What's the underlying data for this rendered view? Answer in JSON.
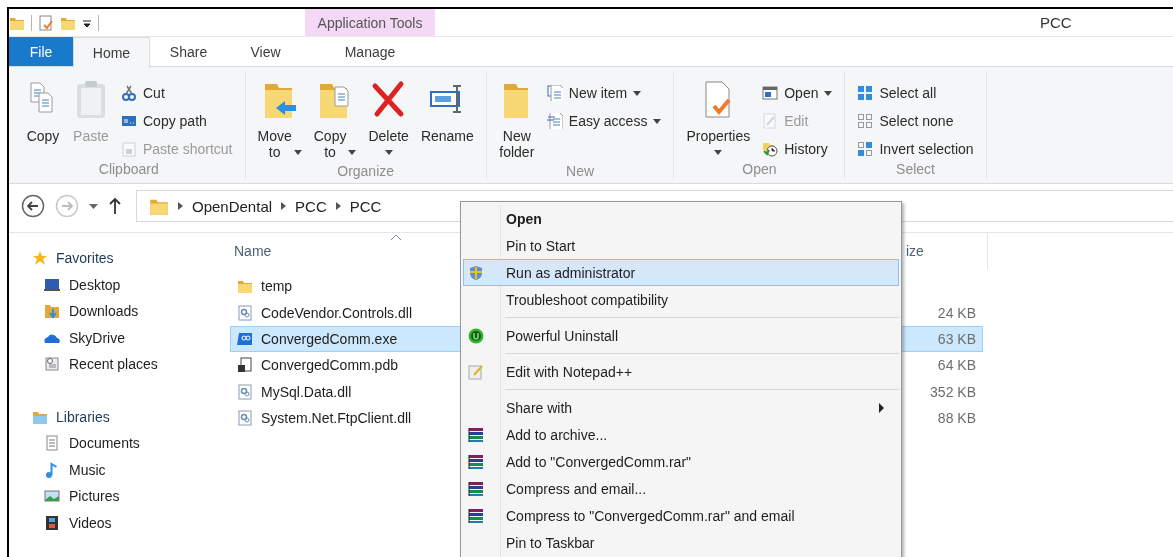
{
  "title_bar": {
    "context_tab_group": "Application Tools",
    "title": "PCC"
  },
  "ribbon_tabs": [
    {
      "label": "File",
      "kind": "file",
      "selected": false
    },
    {
      "label": "Home",
      "kind": "tab",
      "selected": true
    },
    {
      "label": "Share",
      "kind": "tab",
      "selected": false
    },
    {
      "label": "View",
      "kind": "tab",
      "selected": false
    },
    {
      "label": "Manage",
      "kind": "context",
      "selected": false
    }
  ],
  "ribbon_groups": [
    {
      "label": "Clipboard",
      "commands": [
        {
          "label": "Copy",
          "kind": "large",
          "disabled": false,
          "dropdown": false
        },
        {
          "label": "Paste",
          "kind": "large",
          "disabled": true,
          "dropdown": false
        },
        {
          "label": "Cut",
          "kind": "small",
          "disabled": false,
          "dropdown": false
        },
        {
          "label": "Copy path",
          "kind": "small",
          "disabled": false,
          "dropdown": false
        },
        {
          "label": "Paste shortcut",
          "kind": "small",
          "disabled": true,
          "dropdown": false
        }
      ]
    },
    {
      "label": "Organize",
      "commands": [
        {
          "label": "Move to",
          "kind": "large",
          "disabled": false,
          "dropdown": true
        },
        {
          "label": "Copy to",
          "kind": "large",
          "disabled": false,
          "dropdown": true
        },
        {
          "label": "Delete",
          "kind": "tall",
          "disabled": false,
          "dropdown": true
        },
        {
          "label": "Rename",
          "kind": "large",
          "disabled": false,
          "dropdown": false
        }
      ]
    },
    {
      "label": "New",
      "commands": [
        {
          "label": "New folder",
          "kind": "large",
          "disabled": false,
          "dropdown": false
        },
        {
          "label": "New item",
          "kind": "small",
          "disabled": false,
          "dropdown": true
        },
        {
          "label": "Easy access",
          "kind": "small",
          "disabled": false,
          "dropdown": true
        }
      ]
    },
    {
      "label": "Open",
      "commands": [
        {
          "label": "Properties",
          "kind": "tall",
          "disabled": false,
          "dropdown": true
        },
        {
          "label": "Open",
          "kind": "small",
          "disabled": false,
          "dropdown": true
        },
        {
          "label": "Edit",
          "kind": "small",
          "disabled": true,
          "dropdown": false
        },
        {
          "label": "History",
          "kind": "small",
          "disabled": false,
          "dropdown": false
        }
      ]
    },
    {
      "label": "Select",
      "commands": [
        {
          "label": "Select all",
          "kind": "small",
          "disabled": false,
          "dropdown": false
        },
        {
          "label": "Select none",
          "kind": "small",
          "disabled": false,
          "dropdown": false
        },
        {
          "label": "Invert selection",
          "kind": "small",
          "disabled": false,
          "dropdown": false
        }
      ]
    }
  ],
  "address_bar": {
    "forward_disabled": true,
    "path": [
      "OpenDental",
      "PCC",
      "PCC"
    ]
  },
  "navigation": [
    {
      "label": "Favorites",
      "items": [
        "Desktop",
        "Downloads",
        "SkyDrive",
        "Recent places"
      ]
    },
    {
      "label": "Libraries",
      "items": [
        "Documents",
        "Music",
        "Pictures",
        "Videos"
      ]
    }
  ],
  "file_list": {
    "columns": [
      {
        "label": "Name",
        "sorted": true
      },
      {
        "label": "ize",
        "sorted": false
      }
    ],
    "rows": [
      {
        "name": "temp",
        "kind": "folder",
        "size": "",
        "selected": false
      },
      {
        "name": "CodeVendor.Controls.dll",
        "kind": "dll",
        "size": "24 KB",
        "selected": false
      },
      {
        "name": "ConvergedComm.exe",
        "kind": "exe",
        "size": "63 KB",
        "selected": true
      },
      {
        "name": "ConvergedComm.pdb",
        "kind": "pdb",
        "size": "64 KB",
        "selected": false
      },
      {
        "name": "MySql.Data.dll",
        "kind": "dll",
        "size": "352 KB",
        "selected": false
      },
      {
        "name": "System.Net.FtpClient.dll",
        "kind": "dll",
        "size": "88 KB",
        "selected": false
      }
    ]
  },
  "context_menu": {
    "items": [
      {
        "label": "Open",
        "bold": true,
        "selected": false,
        "submenu": false,
        "separator_before": false
      },
      {
        "label": "Pin to Start",
        "bold": false,
        "selected": false,
        "submenu": false,
        "separator_before": false
      },
      {
        "label": "Run as administrator",
        "bold": false,
        "selected": true,
        "submenu": false,
        "separator_before": false
      },
      {
        "label": "Troubleshoot compatibility",
        "bold": false,
        "selected": false,
        "submenu": false,
        "separator_before": false
      },
      {
        "label": "Powerful Uninstall",
        "bold": false,
        "selected": false,
        "submenu": false,
        "separator_before": true
      },
      {
        "label": "Edit with Notepad++",
        "bold": false,
        "selected": false,
        "submenu": false,
        "separator_before": true
      },
      {
        "label": "Share with",
        "bold": false,
        "selected": false,
        "submenu": true,
        "separator_before": true
      },
      {
        "label": "Add to archive...",
        "bold": false,
        "selected": false,
        "submenu": false,
        "separator_before": false
      },
      {
        "label": "Add to \"ConvergedComm.rar\"",
        "bold": false,
        "selected": false,
        "submenu": false,
        "separator_before": false
      },
      {
        "label": "Compress and email...",
        "bold": false,
        "selected": false,
        "submenu": false,
        "separator_before": false
      },
      {
        "label": "Compress to \"ConvergedComm.rar\" and email",
        "bold": false,
        "selected": false,
        "submenu": false,
        "separator_before": false
      },
      {
        "label": "Pin to Taskbar",
        "bold": false,
        "selected": false,
        "submenu": false,
        "separator_before": false
      }
    ]
  }
}
